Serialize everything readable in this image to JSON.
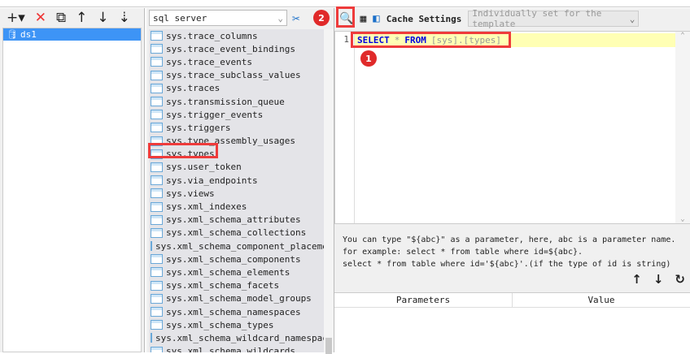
{
  "left": {
    "toolbar": {
      "add": "+▾",
      "delete": "✕",
      "copy": "⧉",
      "up": "↑",
      "down": "↓",
      "sort": "⇣"
    },
    "tree": [
      {
        "label": "ds1"
      }
    ]
  },
  "middle": {
    "db_type": "sql server",
    "tables": [
      "sys.trace_columns",
      "sys.trace_event_bindings",
      "sys.trace_events",
      "sys.trace_subclass_values",
      "sys.traces",
      "sys.transmission_queue",
      "sys.trigger_events",
      "sys.triggers",
      "sys.type_assembly_usages",
      "sys.types",
      "sys.user_token",
      "sys.via_endpoints",
      "sys.views",
      "sys.xml_indexes",
      "sys.xml_schema_attributes",
      "sys.xml_schema_collections",
      "sys.xml_schema_component_placements",
      "sys.xml_schema_components",
      "sys.xml_schema_elements",
      "sys.xml_schema_facets",
      "sys.xml_schema_model_groups",
      "sys.xml_schema_namespaces",
      "sys.xml_schema_types",
      "sys.xml_schema_wildcard_namespaces",
      "sys.xml_schema_wildcards"
    ]
  },
  "right": {
    "cache_label": "Cache Settings",
    "cache_value": "Individually set for the template",
    "editor": {
      "line_no": "1",
      "kw1": "SELECT",
      "star": "*",
      "kw2": "FROM",
      "ident": "[sys].[types]"
    },
    "help": [
      "You can type \"${abc}\" as a parameter, here, abc is a parameter name.",
      "for example: select * from table where id=${abc}.",
      "select * from table where id='${abc}'.(if the type of id is string)"
    ],
    "columns": [
      "Parameters",
      "Value"
    ]
  },
  "badges": [
    "1",
    "2"
  ]
}
